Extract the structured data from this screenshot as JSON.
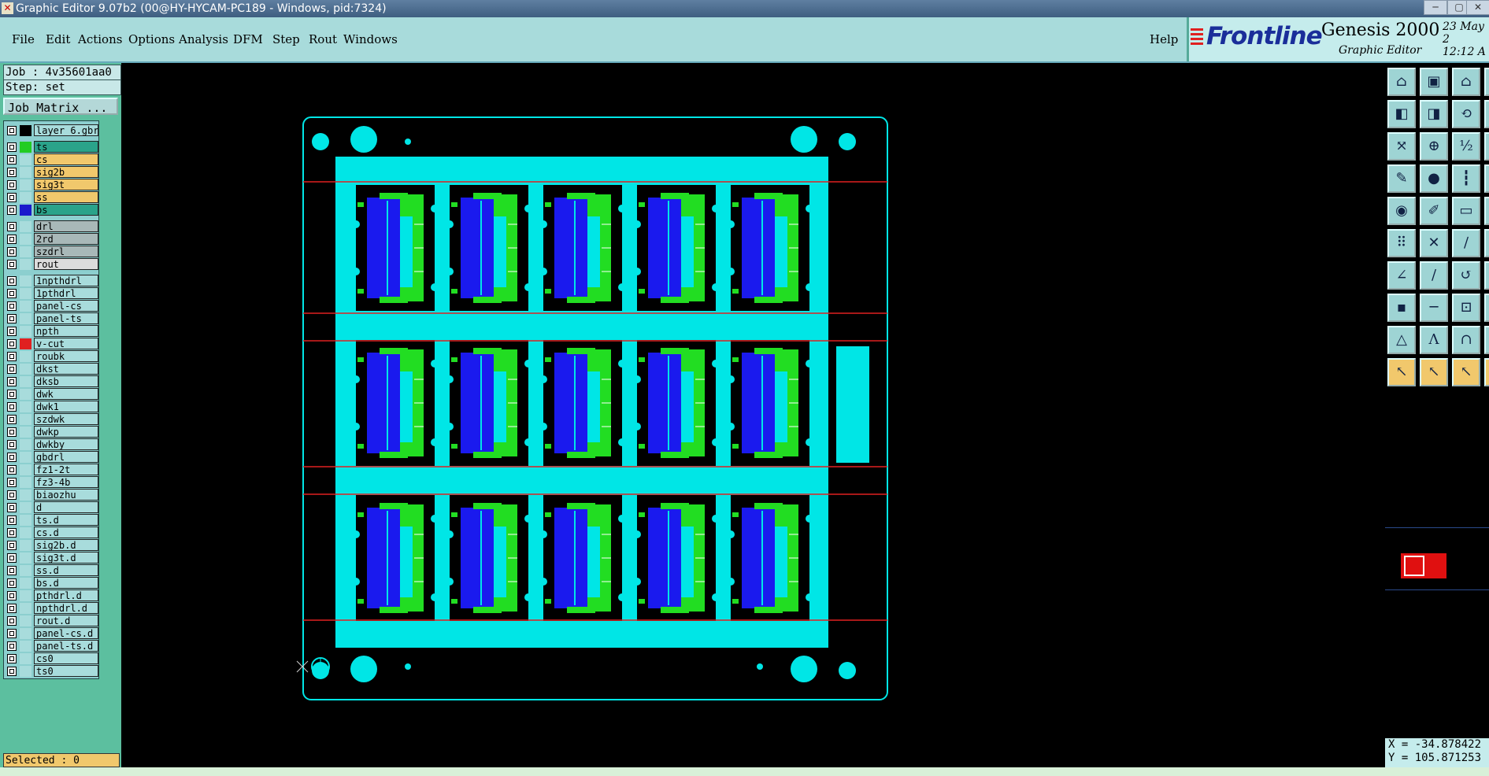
{
  "window": {
    "title": "Graphic Editor 9.07b2 (00@HY-HYCAM-PC189 - Windows, pid:7324)"
  },
  "menu": {
    "items": [
      "File",
      "Edit",
      "Actions",
      "Options",
      "Analysis",
      "DFM",
      "Step",
      "Rout",
      "Windows"
    ],
    "help": "Help"
  },
  "brand": {
    "logo": "Frontline",
    "product": "Genesis 2000",
    "subtitle": "Graphic Editor",
    "date": "23 May 2",
    "time": "12:12 A"
  },
  "job": {
    "job_line": "Job : 4v35601aa0",
    "step_line": "Step: set",
    "matrix_button": "Job Matrix ..."
  },
  "layers": [
    {
      "name": "layer_6.gbr",
      "color": "#a8dcdc",
      "swatch": "#000000",
      "gap_before": false
    },
    {
      "name": "ts",
      "color": "#2aa38a",
      "swatch": "#22cc22",
      "gap_before": true
    },
    {
      "name": "cs",
      "color": "#f1c86c",
      "swatch": "#a8dcdc",
      "gap_before": false
    },
    {
      "name": "sig2b",
      "color": "#f1c86c",
      "swatch": "#a8dcdc",
      "gap_before": false
    },
    {
      "name": "sig3t",
      "color": "#f1c86c",
      "swatch": "#a8dcdc",
      "gap_before": false
    },
    {
      "name": "ss",
      "color": "#f1c86c",
      "swatch": "#a8dcdc",
      "gap_before": false
    },
    {
      "name": "bs",
      "color": "#2aa38a",
      "swatch": "#1a1acc",
      "gap_before": false
    },
    {
      "name": "drl",
      "color": "#a8b8b8",
      "swatch": "#a8dcdc",
      "gap_before": true
    },
    {
      "name": "2rd",
      "color": "#a8b8b8",
      "swatch": "#a8dcdc",
      "gap_before": false
    },
    {
      "name": "szdrl",
      "color": "#a8b8b8",
      "swatch": "#a8dcdc",
      "gap_before": false
    },
    {
      "name": "rout",
      "color": "#dcdcdc",
      "swatch": "#a8dcdc",
      "gap_before": false
    },
    {
      "name": "1npthdrl",
      "color": "#a8dcdc",
      "swatch": "#a8dcdc",
      "gap_before": true
    },
    {
      "name": "1pthdrl",
      "color": "#a8dcdc",
      "swatch": "#a8dcdc",
      "gap_before": false
    },
    {
      "name": "panel-cs",
      "color": "#a8dcdc",
      "swatch": "#a8dcdc",
      "gap_before": false
    },
    {
      "name": "panel-ts",
      "color": "#a8dcdc",
      "swatch": "#a8dcdc",
      "gap_before": false
    },
    {
      "name": "npth",
      "color": "#a8dcdc",
      "swatch": "#a8dcdc",
      "gap_before": false
    },
    {
      "name": "v-cut",
      "color": "#a8dcdc",
      "swatch": "#e02020",
      "gap_before": false
    },
    {
      "name": "roubk",
      "color": "#a8dcdc",
      "swatch": "#a8dcdc",
      "gap_before": false
    },
    {
      "name": "dkst",
      "color": "#a8dcdc",
      "swatch": "#a8dcdc",
      "gap_before": false
    },
    {
      "name": "dksb",
      "color": "#a8dcdc",
      "swatch": "#a8dcdc",
      "gap_before": false
    },
    {
      "name": "dwk",
      "color": "#a8dcdc",
      "swatch": "#a8dcdc",
      "gap_before": false
    },
    {
      "name": "dwk1",
      "color": "#a8dcdc",
      "swatch": "#a8dcdc",
      "gap_before": false
    },
    {
      "name": "szdwk",
      "color": "#a8dcdc",
      "swatch": "#a8dcdc",
      "gap_before": false
    },
    {
      "name": "dwkp",
      "color": "#a8dcdc",
      "swatch": "#a8dcdc",
      "gap_before": false
    },
    {
      "name": "dwkby",
      "color": "#a8dcdc",
      "swatch": "#a8dcdc",
      "gap_before": false
    },
    {
      "name": "gbdrl",
      "color": "#a8dcdc",
      "swatch": "#a8dcdc",
      "gap_before": false
    },
    {
      "name": "fz1-2t",
      "color": "#a8dcdc",
      "swatch": "#a8dcdc",
      "gap_before": false
    },
    {
      "name": "fz3-4b",
      "color": "#a8dcdc",
      "swatch": "#a8dcdc",
      "gap_before": false
    },
    {
      "name": "biaozhu",
      "color": "#a8dcdc",
      "swatch": "#a8dcdc",
      "gap_before": false
    },
    {
      "name": "d",
      "color": "#a8dcdc",
      "swatch": "#a8dcdc",
      "gap_before": false
    },
    {
      "name": "ts.d",
      "color": "#a8dcdc",
      "swatch": "#a8dcdc",
      "gap_before": false
    },
    {
      "name": "cs.d",
      "color": "#a8dcdc",
      "swatch": "#a8dcdc",
      "gap_before": false
    },
    {
      "name": "sig2b.d",
      "color": "#a8dcdc",
      "swatch": "#a8dcdc",
      "gap_before": false
    },
    {
      "name": "sig3t.d",
      "color": "#a8dcdc",
      "swatch": "#a8dcdc",
      "gap_before": false
    },
    {
      "name": "ss.d",
      "color": "#a8dcdc",
      "swatch": "#a8dcdc",
      "gap_before": false
    },
    {
      "name": "bs.d",
      "color": "#a8dcdc",
      "swatch": "#a8dcdc",
      "gap_before": false
    },
    {
      "name": "pthdrl.d",
      "color": "#a8dcdc",
      "swatch": "#a8dcdc",
      "gap_before": false
    },
    {
      "name": "npthdrl.d",
      "color": "#a8dcdc",
      "swatch": "#a8dcdc",
      "gap_before": false
    },
    {
      "name": "rout.d",
      "color": "#a8dcdc",
      "swatch": "#a8dcdc",
      "gap_before": false
    },
    {
      "name": "panel-cs.d",
      "color": "#a8dcdc",
      "swatch": "#a8dcdc",
      "gap_before": false
    },
    {
      "name": "panel-ts.d",
      "color": "#a8dcdc",
      "swatch": "#a8dcdc",
      "gap_before": false
    },
    {
      "name": "cs0",
      "color": "#a8dcdc",
      "swatch": "#a8dcdc",
      "gap_before": false
    },
    {
      "name": "ts0",
      "color": "#a8dcdc",
      "swatch": "#a8dcdc",
      "gap_before": false
    }
  ],
  "status": {
    "selected": "Selected : 0",
    "x": "X = -34.878422",
    "y": "Y = 105.871253"
  },
  "toolbar": [
    {
      "icon": "home-icon",
      "glyph": "⌂"
    },
    {
      "icon": "dock-icon",
      "glyph": "▣"
    },
    {
      "icon": "frame-icon",
      "glyph": "⌂"
    },
    {
      "icon": "panel-icon",
      "glyph": "▯"
    },
    {
      "icon": "pan-left-icon",
      "glyph": "◧"
    },
    {
      "icon": "pan-right-icon",
      "glyph": "◨"
    },
    {
      "icon": "pan-back-icon",
      "glyph": "⟲"
    },
    {
      "icon": "page-icon",
      "glyph": "▯"
    },
    {
      "icon": "zoom-fit-icon",
      "glyph": "⤧"
    },
    {
      "icon": "zoom-in-icon",
      "glyph": "⊕"
    },
    {
      "icon": "zoom-1to2-icon",
      "glyph": "½"
    },
    {
      "icon": "zoom-page-icon",
      "glyph": "▯"
    },
    {
      "icon": "measure-icon",
      "glyph": "✎"
    },
    {
      "icon": "snap-icon",
      "glyph": "●"
    },
    {
      "icon": "ruler-icon",
      "glyph": "┇"
    },
    {
      "icon": "red-icon",
      "glyph": "▯"
    },
    {
      "icon": "camera-icon",
      "glyph": "◉"
    },
    {
      "icon": "edit-icon",
      "glyph": "✐"
    },
    {
      "icon": "grid-icon",
      "glyph": "▭"
    },
    {
      "icon": "side-icon",
      "glyph": "▯"
    },
    {
      "icon": "nodes-icon",
      "glyph": "⠿"
    },
    {
      "icon": "cross-icon",
      "glyph": "✕"
    },
    {
      "icon": "link-icon",
      "glyph": "∕"
    },
    {
      "icon": "panel2-icon",
      "glyph": "▯"
    },
    {
      "icon": "angle-icon",
      "glyph": "∠"
    },
    {
      "icon": "line-icon",
      "glyph": "/"
    },
    {
      "icon": "arc-icon",
      "glyph": "↺"
    },
    {
      "icon": "side2-icon",
      "glyph": "▯"
    },
    {
      "icon": "pad-icon",
      "glyph": "▪"
    },
    {
      "icon": "hline-icon",
      "glyph": "─"
    },
    {
      "icon": "box-icon",
      "glyph": "⊡"
    },
    {
      "icon": "side3-icon",
      "glyph": "▯"
    },
    {
      "icon": "triangle-icon",
      "glyph": "△"
    },
    {
      "icon": "peak-icon",
      "glyph": "Λ"
    },
    {
      "icon": "arch-icon",
      "glyph": "∩"
    },
    {
      "icon": "side4-icon",
      "glyph": "▯"
    },
    {
      "icon": "pointer-icon",
      "glyph": "↖"
    },
    {
      "icon": "pointer-box-icon",
      "glyph": "↖"
    },
    {
      "icon": "pointer-circle-icon",
      "glyph": "↖"
    },
    {
      "icon": "side5-icon",
      "glyph": "▯"
    }
  ]
}
